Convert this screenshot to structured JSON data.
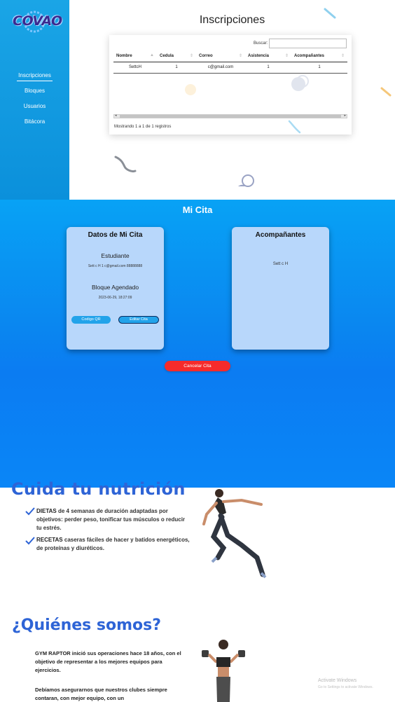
{
  "sidebar": {
    "logo_text": "COVAO",
    "items": [
      {
        "label": "Inscripciones",
        "active": true
      },
      {
        "label": "Bloques",
        "active": false
      },
      {
        "label": "Usuarios",
        "active": false
      },
      {
        "label": "Bitácora",
        "active": false
      }
    ],
    "color": "#1aa5e6"
  },
  "inscripciones": {
    "title": "Inscripciones",
    "search_label": "Buscar:",
    "search_value": "",
    "columns": [
      "Nombre",
      "Cedula",
      "Correo",
      "Asistencia",
      "Acompañantes"
    ],
    "rows": [
      [
        "SettcH",
        "1",
        "c@gmail.com",
        "1",
        "1"
      ]
    ],
    "info": "Mostrando 1 a 1 de 1 registros"
  },
  "cita": {
    "title": "Mi Cita",
    "datos": {
      "heading": "Datos de Mi Cita",
      "estudiante_label": "Estudiante",
      "estudiante_value": "Sett c H 1 c@gmail.com 88888888",
      "bloque_label": "Bloque Agendado",
      "bloque_value": "2023-06-29, 18:27:09",
      "qr_button": "Codigo QR",
      "edit_button": "Editar Cita"
    },
    "acompanantes": {
      "heading": "Acompañantes",
      "value": "Sett c H"
    },
    "cancel_button": "Cancelar Cita",
    "cancel_color": "#f52b2b"
  },
  "nutricion": {
    "title": "Cuida tu nutrición",
    "items": [
      {
        "keyword": "DIETAS",
        "text": " de 4 semanas de duración adaptadas por objetivos: perder peso, tonificar tus músculos o reducir tu estrés."
      },
      {
        "keyword": "RECETAS",
        "text": " caseras fáciles de hacer y batidos energéticos, de proteínas y diuréticos."
      }
    ],
    "check_icon": "check-icon"
  },
  "quienes": {
    "title": "¿Quiénes somos?",
    "p1": "GYM RAPTOR inició sus operaciones hace 18 años, con el objetivo de representar a los mejores equipos para ejercicios.",
    "p2": "Debíamos asegurarnos que nuestros clubes siempre contaran, con mejor equipo, con un"
  },
  "watermark": {
    "line1": "Activate Windows",
    "line2": "Go to Settings to activate Windows."
  },
  "accent": "#2e64d6"
}
